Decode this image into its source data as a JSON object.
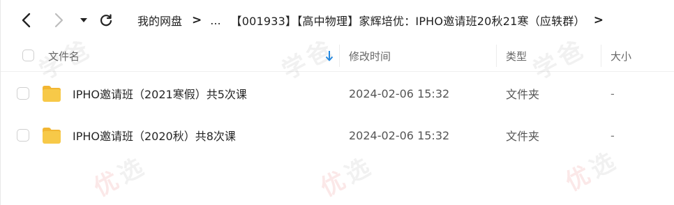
{
  "nav": {
    "back_icon": "chevron-left-icon",
    "forward_icon": "chevron-right-icon",
    "history_icon": "caret-down-icon",
    "refresh_icon": "refresh-icon"
  },
  "breadcrumb": {
    "root": "我的网盘",
    "separator": ">",
    "ellipsis": "...",
    "current": "【001933】【高中物理】家辉培优：IPHO邀请班20秋21寒（应轶群）",
    "trailing_separator": ">"
  },
  "header": {
    "name": "文件名",
    "mtime": "修改时间",
    "type": "类型",
    "size": "大小",
    "sort_icon": "sort-down-arrow-icon"
  },
  "files": [
    {
      "name": "IPHO邀请班（2021寒假）共5次课",
      "mtime": "2024-02-06 15:32",
      "type": "文件夹",
      "size": "-",
      "icon": "folder-icon"
    },
    {
      "name": "IPHO邀请班（2020秋）共8次课",
      "mtime": "2024-02-06 15:32",
      "type": "文件夹",
      "size": "-",
      "icon": "folder-icon"
    }
  ],
  "watermark": {
    "text_a": "学爸",
    "text_b": "优",
    "text_c": "选"
  },
  "colors": {
    "accent": "#1e88e5",
    "folder": "#f7c948",
    "folder_back": "#f2b632"
  }
}
